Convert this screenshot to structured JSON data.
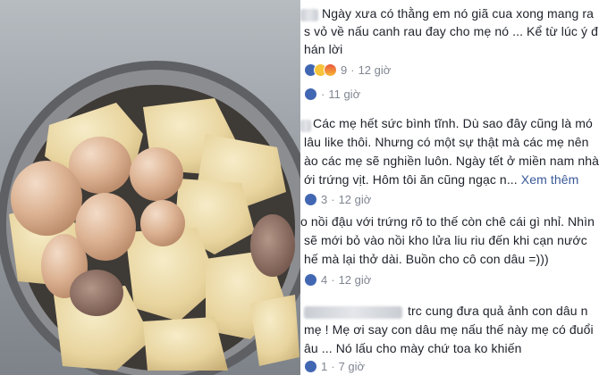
{
  "comments": [
    {
      "lines": [
        "Ngày xưa có thằng em nó giã cua xong mang ra",
        "s vỏ về nấu canh rau đay cho mẹ nó ... Kể từ lúc ý đ",
        "hán lời"
      ],
      "reactions": [
        "like",
        "haha",
        "angry"
      ],
      "count": "9",
      "time": "12 giờ"
    },
    {
      "lines": [],
      "reactions": [
        "like"
      ],
      "count": "",
      "time": "11 giờ"
    },
    {
      "lines": [
        "Các mẹ hết sức bình tĩnh. Dù sao đây cũng là mó",
        "lâu like thôi. Nhưng có một sự thật mà các mẹ nên",
        "ào các mẹ sẽ nghiền luôn. Ngày tết ở miền nam nhà",
        "ới trứng vịt. Hôm tôi ăn cũng ngạc n..."
      ],
      "see_more": "Xem thêm",
      "reactions": [
        "like"
      ],
      "count": "3",
      "time": "12 giờ"
    },
    {
      "lines": [
        "o nồi đậu với trứng rõ to thế còn chê cái gì nhỉ. Nhìn",
        "sẽ mới bỏ vào nồi kho lửa liu riu đến khi cạn nước",
        "hế mà lại thở dài. Buồn cho cô con dâu =)))"
      ],
      "reactions": [
        "like"
      ],
      "count": "4",
      "time": "12 giờ"
    },
    {
      "lines": [
        "trc cung đưa quả ảnh con dâu n",
        "mẹ ! Mẹ ơi say con dâu mẹ nấu thế này mẹ có đuổi",
        "âu ... Nó lấu cho mày chứ toa ko khiến"
      ],
      "reactions": [
        "like"
      ],
      "count": "1",
      "time": "7 giờ"
    }
  ],
  "separator": "·"
}
